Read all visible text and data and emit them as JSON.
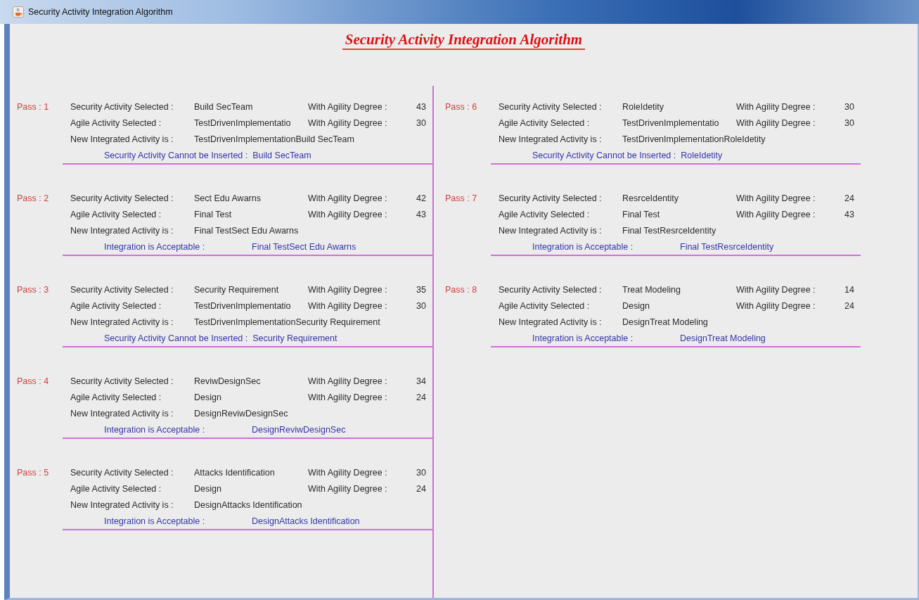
{
  "window": {
    "title": "Security Activity Integration Algorithm"
  },
  "heading": "Security Activity Integration Algorithm",
  "columns": [
    {
      "passes": [
        {
          "label": "Pass : 1",
          "security_label": "Security Activity Selected :",
          "security_activity": "Build SecTeam",
          "security_degree_label": "With Agility Degree :",
          "security_degree": "43",
          "agile_label": "Agile Activity Selected :",
          "agile_activity": "TestDrivenImplementatio",
          "agile_degree_label": "With Agility Degree :",
          "agile_degree": "30",
          "integrated_label": "New Integrated Activity is :",
          "integrated_activity": "TestDrivenImplementationBuild SecTeam",
          "result": {
            "kind": "rejected",
            "label": "Security Activity Cannot be Inserted :",
            "value": "Build SecTeam"
          }
        },
        {
          "label": "Pass : 2",
          "security_label": "Security Activity Selected :",
          "security_activity": "Sect Edu Awarns",
          "security_degree_label": "With Agility Degree :",
          "security_degree": "42",
          "agile_label": "Agile Activity Selected :",
          "agile_activity": "Final Test",
          "agile_degree_label": "With Agility Degree :",
          "agile_degree": "43",
          "integrated_label": "New Integrated Activity is :",
          "integrated_activity": "Final TestSect Edu Awarns",
          "result": {
            "kind": "accepted",
            "label": "Integration is Acceptable :",
            "value": "Final TestSect Edu Awarns"
          }
        },
        {
          "label": "Pass : 3",
          "security_label": "Security Activity Selected :",
          "security_activity": "Security Requirement",
          "security_degree_label": "With Agility Degree :",
          "security_degree": "35",
          "agile_label": "Agile Activity Selected :",
          "agile_activity": "TestDrivenImplementatio",
          "agile_degree_label": "With Agility Degree :",
          "agile_degree": "30",
          "integrated_label": "New Integrated Activity is :",
          "integrated_activity": "TestDrivenImplementationSecurity Requirement",
          "result": {
            "kind": "rejected",
            "label": "Security Activity Cannot be Inserted :",
            "value": "Security Requirement"
          }
        },
        {
          "label": "Pass : 4",
          "security_label": "Security Activity Selected :",
          "security_activity": "ReviwDesignSec",
          "security_degree_label": "With Agility Degree :",
          "security_degree": "34",
          "agile_label": "Agile Activity Selected :",
          "agile_activity": "Design",
          "agile_degree_label": "With Agility Degree :",
          "agile_degree": "24",
          "integrated_label": "New Integrated Activity is :",
          "integrated_activity": "DesignReviwDesignSec",
          "result": {
            "kind": "accepted",
            "label": "Integration is Acceptable :",
            "value": "DesignReviwDesignSec"
          }
        },
        {
          "label": "Pass : 5",
          "security_label": "Security Activity Selected :",
          "security_activity": "Attacks Identification",
          "security_degree_label": "With Agility Degree :",
          "security_degree": "30",
          "agile_label": "Agile Activity Selected :",
          "agile_activity": "Design",
          "agile_degree_label": "With Agility Degree :",
          "agile_degree": "24",
          "integrated_label": "New Integrated Activity is :",
          "integrated_activity": "DesignAttacks Identification",
          "result": {
            "kind": "accepted",
            "label": "Integration is Acceptable :",
            "value": "DesignAttacks Identification"
          }
        }
      ]
    },
    {
      "passes": [
        {
          "label": "Pass : 6",
          "security_label": "Security Activity Selected :",
          "security_activity": "RoleIdetity",
          "security_degree_label": "With Agility Degree :",
          "security_degree": "30",
          "agile_label": "Agile Activity Selected :",
          "agile_activity": "TestDrivenImplementatio",
          "agile_degree_label": "With Agility Degree :",
          "agile_degree": "30",
          "integrated_label": "New Integrated Activity is :",
          "integrated_activity": "TestDrivenImplementationRoleIdetity",
          "result": {
            "kind": "rejected",
            "label": "Security Activity Cannot be Inserted :",
            "value": "RoleIdetity"
          }
        },
        {
          "label": "Pass : 7",
          "security_label": "Security Activity Selected :",
          "security_activity": "ResrceIdentity",
          "security_degree_label": "With Agility Degree :",
          "security_degree": "24",
          "agile_label": "Agile Activity Selected :",
          "agile_activity": "Final Test",
          "agile_degree_label": "With Agility Degree :",
          "agile_degree": "43",
          "integrated_label": "New Integrated Activity is :",
          "integrated_activity": "Final TestResrceIdentity",
          "result": {
            "kind": "accepted",
            "label": "Integration is Acceptable :",
            "value": "Final TestResrceIdentity"
          }
        },
        {
          "label": "Pass : 8",
          "security_label": "Security Activity Selected :",
          "security_activity": "Treat Modeling",
          "security_degree_label": "With Agility Degree :",
          "security_degree": "14",
          "agile_label": "Agile Activity Selected :",
          "agile_activity": "Design",
          "agile_degree_label": "With Agility Degree :",
          "agile_degree": "24",
          "integrated_label": "New Integrated Activity is :",
          "integrated_activity": "DesignTreat Modeling",
          "result": {
            "kind": "accepted",
            "label": "Integration is Acceptable :",
            "value": "DesignTreat Modeling"
          }
        }
      ]
    }
  ]
}
